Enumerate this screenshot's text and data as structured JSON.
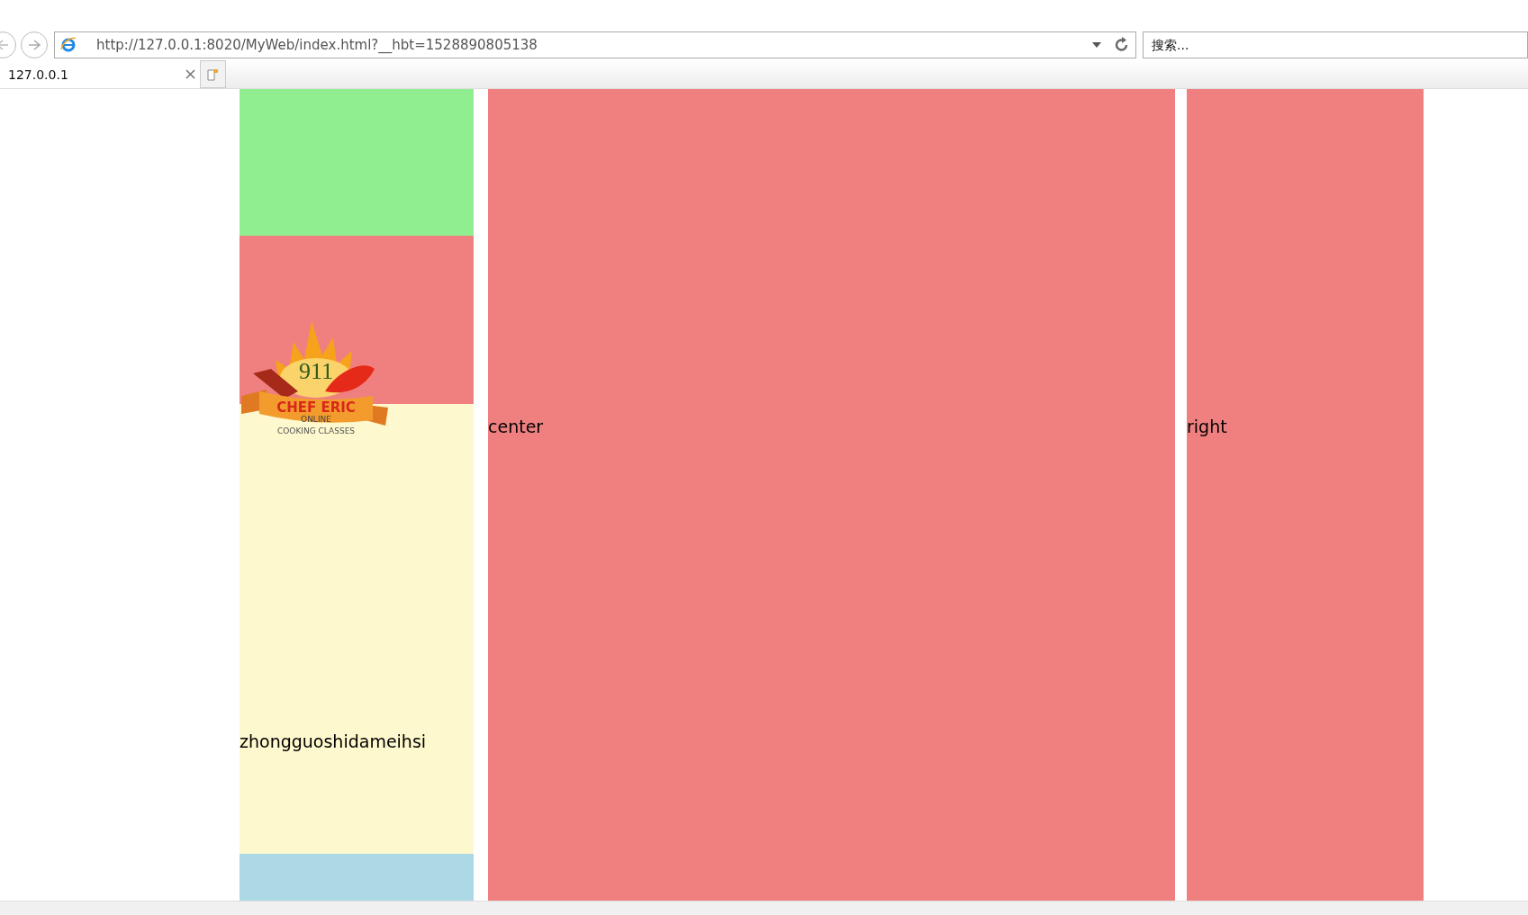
{
  "browser": {
    "address": "http://127.0.0.1:8020/MyWeb/index.html?__hbt=1528890805138",
    "search": {
      "placeholder": "搜索..."
    },
    "tabs": [
      {
        "label": "127.0.0.1",
        "selected": true
      }
    ]
  },
  "page": {
    "left": {
      "logo": {
        "number": "911",
        "name": "CHEF ERIC",
        "line": "ONLINE",
        "subline": "COOKING CLASSES"
      },
      "text": "zhongguoshidameihsi"
    },
    "center": {
      "text": "center"
    },
    "right": {
      "text": "right"
    }
  }
}
